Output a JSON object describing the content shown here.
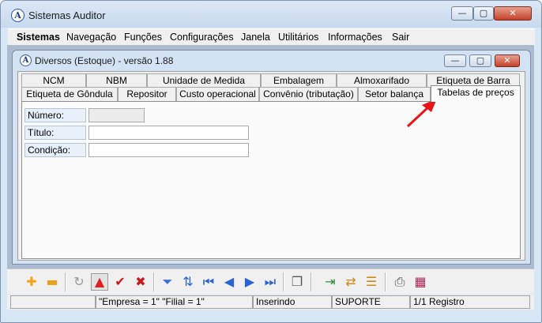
{
  "app": {
    "title": "Sistemas Auditor",
    "icon": "auditor-logo-icon",
    "icon_letter": "A",
    "minimize": "—",
    "maximize": "▢",
    "close": "✕"
  },
  "menu": [
    "Sistemas",
    "Navegação",
    "Funções",
    "Configurações",
    "Janela",
    "Utilitários",
    "Informações",
    "Sair"
  ],
  "child": {
    "title": "Diversos (Estoque) - versão 1.88",
    "icon_letter": "A"
  },
  "tabs_row1": [
    "NCM",
    "NBM",
    "Unidade de Medida",
    "Embalagem",
    "Almoxarifado",
    "Etiqueta de Barra"
  ],
  "tabs_row2": [
    "Etiqueta de Gôndula",
    "Repositor",
    "Custo operacional",
    "Convênio (tributação)",
    "Setor balança",
    "Tabelas de preços"
  ],
  "active_tab": "Tabelas de preços",
  "form": {
    "numero_label": "Número:",
    "titulo_label": "Título:",
    "condicao_label": "Condição:",
    "numero_value": "",
    "titulo_value": "",
    "condicao_value": ""
  },
  "toolbar": {
    "icons": [
      "add-icon",
      "remove-icon",
      "refresh-icon",
      "first-record-triangle-icon",
      "confirm-check-icon",
      "cancel-x-icon",
      "filter-funnel-icon",
      "sort-icon",
      "first-icon",
      "previous-icon",
      "next-icon",
      "last-icon",
      "copy-icon",
      "export-icon",
      "import-icon",
      "list-edit-icon",
      "print-icon",
      "calendar-report-icon"
    ],
    "glyphs": {
      "add": "✚",
      "remove": "▬",
      "refresh": "↻",
      "up": "▲",
      "check": "✔",
      "cancel": "✖",
      "filter": "⏷",
      "sort": "⇅",
      "first": "⏮",
      "prev": "◀",
      "next": "▶",
      "last": "⏭",
      "copy": "❐",
      "export": "⇥",
      "import": "⇄",
      "listedit": "☰",
      "print": "⎙",
      "calendar": "▦"
    }
  },
  "status": {
    "empresa_filial": "\"Empresa = 1\"   \"Filial = 1\"",
    "mode": "Inserindo",
    "user": "SUPORTE",
    "records": "1/1 Registro"
  },
  "colors": {
    "accent_arrow": "#e8141a",
    "add": "#f3a21a",
    "remove": "#e7a21a",
    "up": "#e0201c",
    "check": "#c81818",
    "cancel": "#c81818",
    "nav": "#2b63d3",
    "filter": "#3a70d8"
  }
}
